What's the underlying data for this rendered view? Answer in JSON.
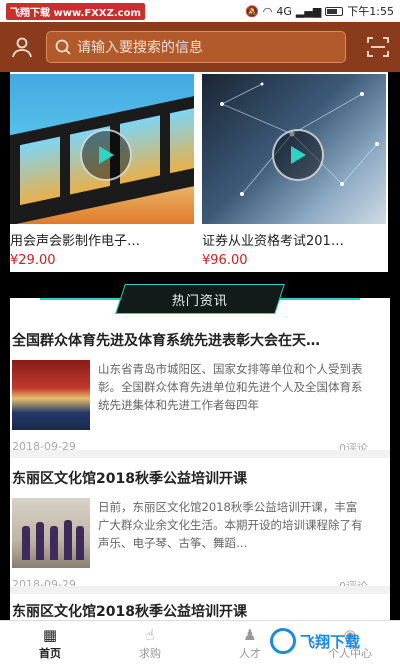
{
  "status_bar": {
    "watermark": "飞翔下载 www.FXXZ.com",
    "network": "4G",
    "time": "下午1:55"
  },
  "header": {
    "search_placeholder": "请输入要搜索的信息"
  },
  "courses": [
    {
      "title": "用会声会影制作电子…",
      "price": "¥29.00"
    },
    {
      "title": "证券从业资格考试201…",
      "price": "¥96.00"
    }
  ],
  "news_section": {
    "heading": "热门资讯",
    "items": [
      {
        "title": "全国群众体育先进及体育系统先进表彰大会在天…",
        "desc": "山东省青岛市城阳区、国家女排等单位和个人受到表彰。全国群众体育先进单位和先进个人及全国体育系统先进集体和先进工作者每四年",
        "date": "2018-09-29",
        "comments": "0评论"
      },
      {
        "title": "东丽区文化馆2018秋季公益培训开课",
        "desc": "日前，东丽区文化馆2018秋季公益培训开课，丰富广大群众业余文化生活。本期开设的培训课程除了有声乐、电子琴、古筝、舞蹈…",
        "date": "2018-09-29",
        "comments": "0评论"
      },
      {
        "title": "东丽区文化馆2018秋季公益培训开课"
      }
    ]
  },
  "tabbar": {
    "tabs": [
      {
        "label": "首页",
        "icon": "home-icon",
        "active": true
      },
      {
        "label": "求购",
        "icon": "hand-icon"
      },
      {
        "label": "人才",
        "icon": "person-icon"
      },
      {
        "label": "个人中心",
        "icon": "user-center-icon"
      }
    ]
  },
  "site_logo": {
    "text": "飞翔下载"
  }
}
